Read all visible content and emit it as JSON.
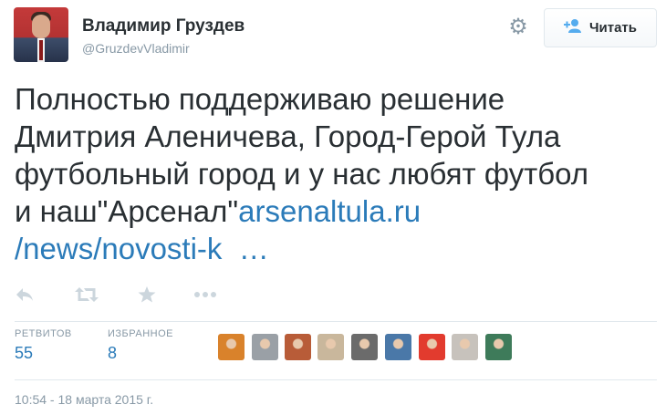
{
  "user": {
    "name": "Владимир Груздев",
    "handle": "@GruzdevVladimir"
  },
  "follow_button": {
    "label": "Читать"
  },
  "tweet": {
    "line1": "Полностью поддерживаю решение",
    "line2": "Дмитрия Аленичева, Город-Герой Тула",
    "line3": "футбольный город и у нас любят футбол",
    "line4_text": "и наш\"Арсенал\"",
    "link_part1": "arsenaltula.ru",
    "link_part2": "/news/novosti-k",
    "ellipsis": "…"
  },
  "actions": {
    "reply_icon": "reply-icon",
    "retweet_icon": "retweet-icon",
    "favorite_icon": "star-icon",
    "more_icon": "more-icon"
  },
  "stats": {
    "retweets_label": "РЕТВИТОВ",
    "retweets_count": "55",
    "favorites_label": "ИЗБРАННОЕ",
    "favorites_count": "8"
  },
  "favoriters": [
    {
      "color": "#d9822b"
    },
    {
      "color": "#9aa0a6"
    },
    {
      "color": "#b85c38"
    },
    {
      "color": "#c9b79c"
    },
    {
      "color": "#6b6b6b"
    },
    {
      "color": "#4a78a8"
    },
    {
      "color": "#e23b2e"
    },
    {
      "color": "#c7c2bc"
    },
    {
      "color": "#3e7b5a"
    }
  ],
  "timestamp": "10:54 - 18 марта 2015 г.",
  "colors": {
    "link": "#2b7bb9",
    "muted": "#8899a6",
    "text": "#292f33"
  }
}
